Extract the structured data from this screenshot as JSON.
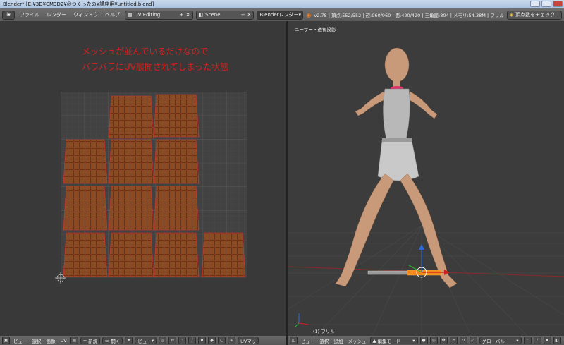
{
  "window": {
    "title": "Blender* [E:¥3D¥CM3D2¥@つくったの¥講座用¥untitled.blend]"
  },
  "header": {
    "editor_type": "i",
    "menus": [
      "ファイル",
      "レンダー",
      "ウィンドウ",
      "ヘルプ"
    ],
    "layout": "UV Editing",
    "scene": "Scene",
    "renderer": "Blenderレンダー",
    "stats": "v2.78 | 頂点:552/552 | 辺:960/960 | 面:420/420 | 三角面:804 | メモリ:54.38M | フリル",
    "check_button": "頂点数をチェック"
  },
  "uv_editor": {
    "annotation_line1": "メッシュが並んでいるだけなので",
    "annotation_line2": "バラバラにUV展開されてしまった状態",
    "footer_menus": [
      "ビュー",
      "選択",
      "画像",
      "UV"
    ],
    "new_button": "新規",
    "open_button": "開く",
    "view_field": "ビュー",
    "uv_map_field": "UVマッ"
  },
  "viewport": {
    "view_label": "ユーザー・透視投影",
    "object_label": "(1) フリル",
    "footer_menus": [
      "ビュー",
      "選択",
      "追加",
      "メッシュ"
    ],
    "mode": "編集モード",
    "orientation": "グローバル"
  },
  "colors": {
    "uv_fill": "#8b4a22",
    "uv_edge": "#2b1508",
    "uv_vertex": "#e03030",
    "annotation": "#e01d1d",
    "skin": "#c89a7a"
  }
}
